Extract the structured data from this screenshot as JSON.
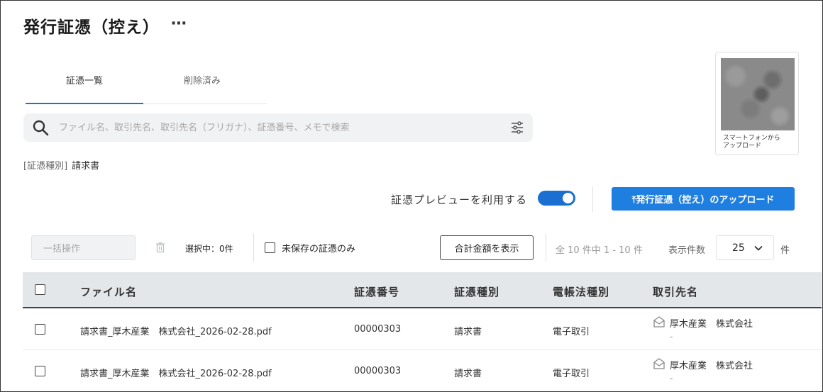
{
  "header": {
    "title": "発行証憑（控え）",
    "more_label": "⋯"
  },
  "tabs": [
    {
      "label": "証憑一覧",
      "active": true
    },
    {
      "label": "削除済み",
      "active": false
    }
  ],
  "search": {
    "placeholder": "ファイル名、取引先名、取引先名（フリガナ）、証憑番号、メモで検索",
    "value": ""
  },
  "filter": {
    "key": "[証憑種別]",
    "value": "請求書"
  },
  "qr": {
    "label": "スマートフォンから\nアップロード"
  },
  "toolbar": {
    "preview_label": "証憑プレビューを利用する",
    "preview_enabled": true,
    "upload_label": "⤒発行証憑（控え）のアップロード",
    "bulk_label": "一括操作",
    "selected_label": "選択中：0件",
    "unsaved_only_label": "未保存の証憑のみ",
    "total_label": "合計金額を表示",
    "range_label": "全 10 件中 1 - 10 件",
    "perpage_label": "表示件数",
    "perpage_value": "25",
    "perpage_unit": "件"
  },
  "table": {
    "columns": [
      "ファイル名",
      "証憑番号",
      "証憑種別",
      "電帳法種別",
      "取引先名"
    ],
    "rows": [
      {
        "file_name": "請求書_厚木産業　株式会社_2026-02-28.pdf",
        "number": "00000303",
        "type": "請求書",
        "law_type": "電子取引",
        "partner": "厚木産業　株式会社",
        "partner_sub": "-"
      },
      {
        "file_name": "請求書_厚木産業　株式会社_2026-02-28.pdf",
        "number": "00000303",
        "type": "請求書",
        "law_type": "電子取引",
        "partner": "厚木産業　株式会社",
        "partner_sub": "-"
      }
    ]
  },
  "colors": {
    "accent": "#1f7fe0",
    "toggle": "#1a6fd1",
    "header_bg": "#e4e7ea",
    "search_bg": "#f1f2f4"
  }
}
